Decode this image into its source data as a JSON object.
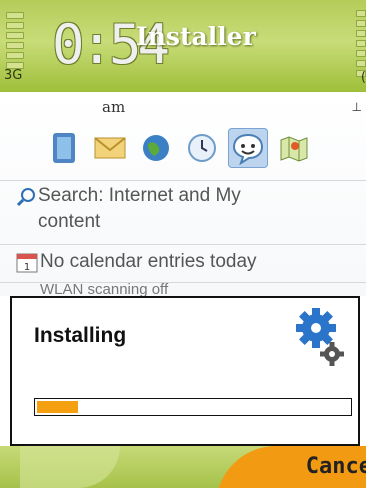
{
  "statusbar": {
    "network": "3G",
    "clock": "0:54",
    "app_title": "Installer",
    "corner": "("
  },
  "home": {
    "ampm": "am",
    "tray_icon": "⊥",
    "shortcuts": [
      {
        "icon": "contacts-icon",
        "selected": false
      },
      {
        "icon": "messaging-icon",
        "selected": false
      },
      {
        "icon": "web-icon",
        "selected": false
      },
      {
        "icon": "clock-icon",
        "selected": false
      },
      {
        "icon": "chat-icon",
        "selected": true
      },
      {
        "icon": "maps-icon",
        "selected": false
      }
    ],
    "search_line1": "Search: Internet and My",
    "search_line2": "content",
    "calendar": "No calendar entries today",
    "partial": "WLAN scanning off"
  },
  "dialog": {
    "title": "Installing",
    "progress": 0.13,
    "progress_color": "#f5a010"
  },
  "softkeys": {
    "right": "Cance"
  }
}
